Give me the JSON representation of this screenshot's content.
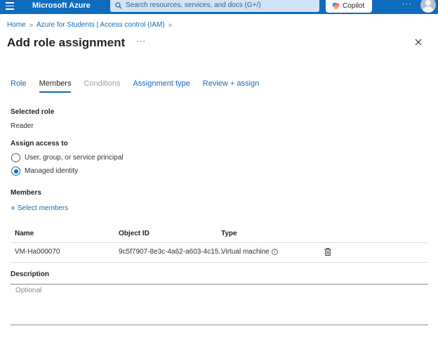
{
  "topbar": {
    "brand": "Microsoft Azure",
    "search_placeholder": "Search resources, services, and docs (G+/)",
    "copilot_label": "Copilot",
    "more": "···"
  },
  "breadcrumb": {
    "items": [
      "Home",
      "Azure for Students | Access control (IAM)"
    ],
    "separator": ">"
  },
  "page": {
    "title": "Add role assignment",
    "more": "···"
  },
  "tabs": [
    {
      "label": "Role",
      "state": "link"
    },
    {
      "label": "Members",
      "state": "active"
    },
    {
      "label": "Conditions",
      "state": "disabled"
    },
    {
      "label": "Assignment type",
      "state": "link"
    },
    {
      "label": "Review + assign",
      "state": "link"
    }
  ],
  "selected_role": {
    "label": "Selected role",
    "value": "Reader"
  },
  "assign_access": {
    "label": "Assign access to",
    "options": [
      {
        "label": "User, group, or service principal",
        "checked": false
      },
      {
        "label": "Managed identity",
        "checked": true
      }
    ]
  },
  "members": {
    "label": "Members",
    "select_link": "Select members",
    "columns": [
      "Name",
      "Object ID",
      "Type"
    ],
    "rows": [
      {
        "name": "VM-Ha000070",
        "object_id": "9c5f7907-8e3c-4a62-a603-4c15...",
        "type": "Virtual machine"
      }
    ]
  },
  "description": {
    "label": "Description",
    "placeholder": "Optional"
  },
  "colors": {
    "brand_blue": "#0f6cbd",
    "search_bg": "#d1e4f7",
    "text": "#323130",
    "disabled": "#a19f9d"
  }
}
